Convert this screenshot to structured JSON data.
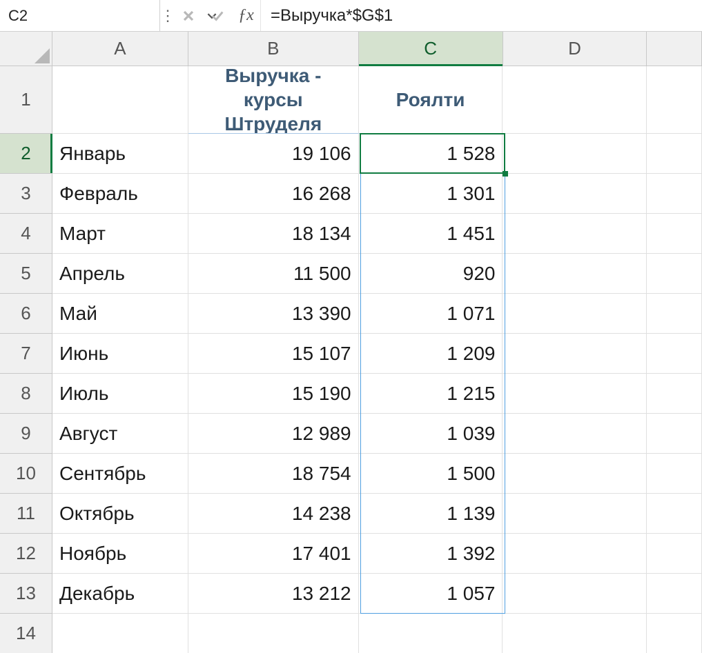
{
  "name_box": "C2",
  "formula": "=Выручка*$G$1",
  "fx_label": "ƒx",
  "columns": [
    "A",
    "B",
    "C",
    "D"
  ],
  "active_col_index": 2,
  "row_header_count": 14,
  "active_row_index": 1,
  "headers": {
    "A": "",
    "B": "Выручка - курсы\nШтруделя",
    "C": "Роялти",
    "D": ""
  },
  "rows": [
    {
      "month": "Январь",
      "rev": "19 106",
      "roy": "1 528"
    },
    {
      "month": "Февраль",
      "rev": "16 268",
      "roy": "1 301"
    },
    {
      "month": "Март",
      "rev": "18 134",
      "roy": "1 451"
    },
    {
      "month": "Апрель",
      "rev": "11 500",
      "roy": "920"
    },
    {
      "month": "Май",
      "rev": "13 390",
      "roy": "1 071"
    },
    {
      "month": "Июнь",
      "rev": "15 107",
      "roy": "1 209"
    },
    {
      "month": "Июль",
      "rev": "15 190",
      "roy": "1 215"
    },
    {
      "month": "Август",
      "rev": "12 989",
      "roy": "1 039"
    },
    {
      "month": "Сентябрь",
      "rev": "18 754",
      "roy": "1 500"
    },
    {
      "month": "Октябрь",
      "rev": "14 238",
      "roy": "1 139"
    },
    {
      "month": "Ноябрь",
      "rev": "17 401",
      "roy": "1 392"
    },
    {
      "month": "Декабрь",
      "rev": "13 212",
      "roy": "1 057"
    }
  ],
  "layout": {
    "col_widths": {
      "A": 198,
      "B": 248,
      "C": 210,
      "D": 210
    },
    "head_row_h": 98,
    "body_row_h": 58
  }
}
